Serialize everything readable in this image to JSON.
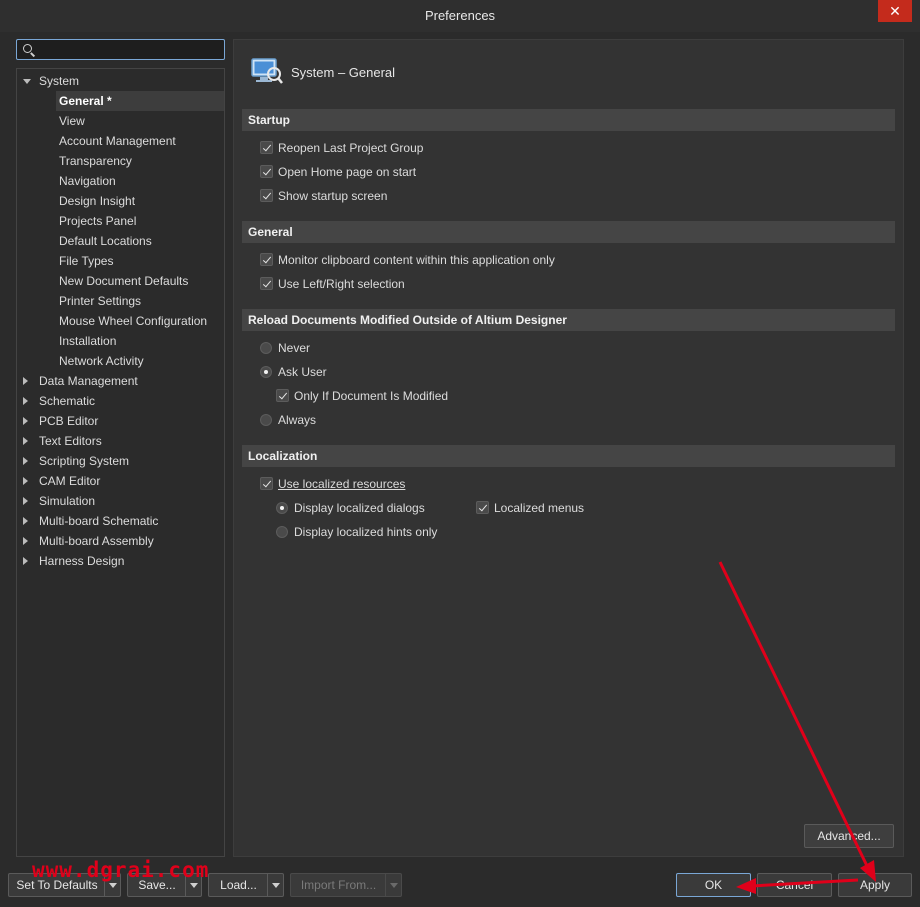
{
  "window": {
    "title": "Preferences",
    "close_glyph": "✕"
  },
  "search": {
    "value": "",
    "placeholder": ""
  },
  "tree": {
    "system": "System",
    "system_children": [
      "General *",
      "View",
      "Account Management",
      "Transparency",
      "Navigation",
      "Design Insight",
      "Projects Panel",
      "Default Locations",
      "File Types",
      "New Document Defaults",
      "Printer Settings",
      "Mouse Wheel Configuration",
      "Installation",
      "Network Activity"
    ],
    "roots": [
      "Data Management",
      "Schematic",
      "PCB Editor",
      "Text Editors",
      "Scripting System",
      "CAM Editor",
      "Simulation",
      "Multi-board Schematic",
      "Multi-board Assembly",
      "Harness Design"
    ]
  },
  "page": {
    "title": "System – General",
    "icon": "system-general-icon"
  },
  "sections": {
    "startup": {
      "title": "Startup",
      "options": [
        {
          "label": "Reopen Last Project Group",
          "checked": true
        },
        {
          "label": "Open Home page on start",
          "checked": true
        },
        {
          "label": "Show startup screen",
          "checked": true
        }
      ]
    },
    "general": {
      "title": "General",
      "options": [
        {
          "label": "Monitor clipboard content within this application only",
          "checked": true
        },
        {
          "label": "Use Left/Right selection",
          "checked": true
        }
      ]
    },
    "reload": {
      "title": "Reload Documents Modified Outside of Altium Designer",
      "never": "Never",
      "ask_user": "Ask User",
      "only_if_modified": "Only If Document Is Modified",
      "always": "Always",
      "selected": "Ask User"
    },
    "localization": {
      "title": "Localization",
      "use_localized": "Use localized resources",
      "display_dialogs": "Display localized dialogs",
      "display_hints": "Display localized hints only",
      "localized_menus": "Localized menus"
    }
  },
  "buttons": {
    "advanced": "Advanced...",
    "set_defaults": "Set To Defaults",
    "save": "Save...",
    "load": "Load...",
    "import_from": "Import From...",
    "ok": "OK",
    "cancel": "Cancel",
    "apply": "Apply"
  },
  "watermark": "www.dgrai.com",
  "colors": {
    "accent": "#7aa7d6",
    "close": "#c42b1c",
    "annotation": "#e0001a"
  }
}
